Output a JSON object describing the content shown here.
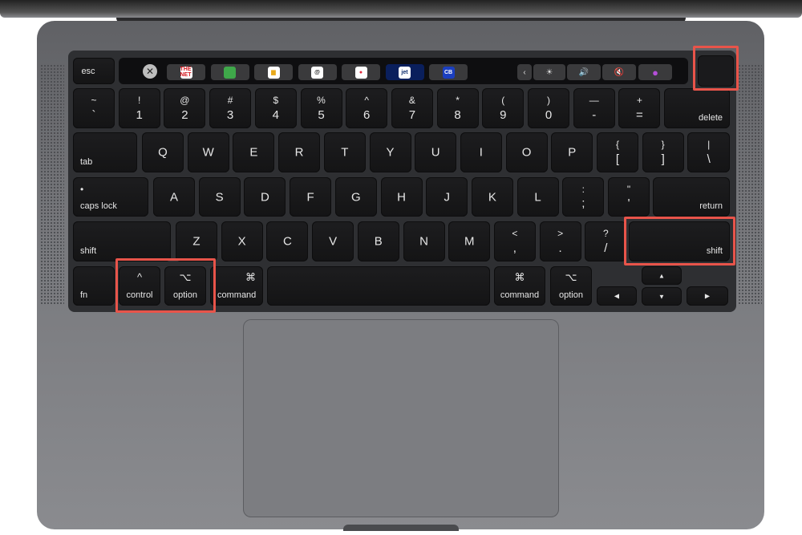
{
  "touch_bar": {
    "esc": "esc",
    "apps": [
      {
        "name": "thenet-app-icon",
        "label": "THE NET",
        "bg": "#ffffff",
        "fg": "#d6171e"
      },
      {
        "name": "leaf-app-icon",
        "label": "",
        "bg": "#3fa84a",
        "fg": "#fff"
      },
      {
        "name": "cup-app-icon",
        "label": "▆",
        "bg": "#ffffff",
        "fg": "#e8a91b"
      },
      {
        "name": "scribble-app-icon",
        "label": "@",
        "bg": "#ffffff",
        "fg": "#222"
      },
      {
        "name": "record-app-icon",
        "label": "●",
        "bg": "#ffffff",
        "fg": "#e0263a"
      },
      {
        "name": "jet-app-icon",
        "label": "jet",
        "bg": "#ffffff",
        "fg": "#0a2a6b",
        "button_bg": "#0a1f5c"
      },
      {
        "name": "cb-app-icon",
        "label": "CB",
        "bg": "#1b3fbf",
        "fg": "#ffffff"
      }
    ],
    "controls": [
      {
        "name": "collapse-chevron-icon",
        "label": "‹"
      },
      {
        "name": "brightness-icon",
        "label": "☀"
      },
      {
        "name": "volume-icon",
        "label": "🔊"
      },
      {
        "name": "mute-icon",
        "label": "🔇"
      },
      {
        "name": "siri-icon",
        "label": "●"
      }
    ]
  },
  "rows": [
    [
      [
        "~",
        "`"
      ],
      [
        "!",
        "1"
      ],
      [
        "@",
        "2"
      ],
      [
        "#",
        "3"
      ],
      [
        "$",
        "4"
      ],
      [
        "%",
        "5"
      ],
      [
        "^",
        "6"
      ],
      [
        "&",
        "7"
      ],
      [
        "*",
        "8"
      ],
      [
        "(",
        "9"
      ],
      [
        ")",
        "0"
      ],
      [
        "—",
        "-"
      ],
      [
        "+",
        "="
      ],
      [
        "",
        "delete"
      ]
    ],
    [
      [
        "",
        "tab"
      ],
      [
        "",
        "Q"
      ],
      [
        "",
        "W"
      ],
      [
        "",
        "E"
      ],
      [
        "",
        "R"
      ],
      [
        "",
        "T"
      ],
      [
        "",
        "Y"
      ],
      [
        "",
        "U"
      ],
      [
        "",
        "I"
      ],
      [
        "",
        "O"
      ],
      [
        "",
        "P"
      ],
      [
        "{",
        "["
      ],
      [
        "}",
        "]"
      ],
      [
        "|",
        "\\"
      ]
    ],
    [
      [
        "•",
        "caps lock"
      ],
      [
        "",
        "A"
      ],
      [
        "",
        "S"
      ],
      [
        "",
        "D"
      ],
      [
        "",
        "F"
      ],
      [
        "",
        "G"
      ],
      [
        "",
        "H"
      ],
      [
        "",
        "J"
      ],
      [
        "",
        "K"
      ],
      [
        "",
        "L"
      ],
      [
        ":",
        ";"
      ],
      [
        "\"",
        "'"
      ],
      [
        "",
        "return"
      ]
    ],
    [
      [
        "",
        "shift"
      ],
      [
        "",
        "Z"
      ],
      [
        "",
        "X"
      ],
      [
        "",
        "C"
      ],
      [
        "",
        "V"
      ],
      [
        "",
        "B"
      ],
      [
        "",
        "N"
      ],
      [
        "",
        "M"
      ],
      [
        "<",
        ","
      ],
      [
        ">",
        "."
      ],
      [
        "?",
        "/"
      ],
      [
        "",
        "shift"
      ]
    ],
    [
      [
        "",
        "fn"
      ],
      [
        "^",
        "control"
      ],
      [
        "⌥",
        "option"
      ],
      [
        "⌘",
        "command"
      ],
      [
        "",
        ""
      ],
      [
        "⌘",
        "command"
      ],
      [
        "⌥",
        "option"
      ],
      [
        "",
        "◀"
      ],
      [
        "",
        "▲"
      ],
      [
        "",
        "▼"
      ],
      [
        "",
        "▶"
      ]
    ]
  ],
  "highlight_color": "#e8544a",
  "highlighted_keys": [
    "touch-id",
    "control",
    "option",
    "right-shift"
  ]
}
